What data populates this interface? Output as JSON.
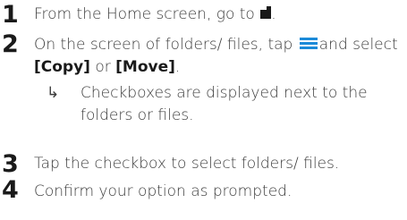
{
  "steps": [
    {
      "number": "1",
      "text_before": "From the Home screen, go to",
      "icon": "folder-icon",
      "text_after": "."
    },
    {
      "number": "2",
      "text_before": "On the screen of folders/ files, tap",
      "icon": "menu-icon",
      "text_middle": "and select",
      "option1": "[Copy]",
      "or_text": "or",
      "option2": "[Move]",
      "period": ".",
      "result_arrow": "↳",
      "result_text": "Checkboxes are displayed next to the folders or files."
    },
    {
      "number": "3",
      "text": "Tap the checkbox to select folders/ files."
    },
    {
      "number": "4",
      "text": "Confirm your option as prompted."
    }
  ],
  "colors": {
    "menu_icon": "#1b8ad8",
    "text": "#3c3c3c",
    "number": "#1a1a1a"
  }
}
